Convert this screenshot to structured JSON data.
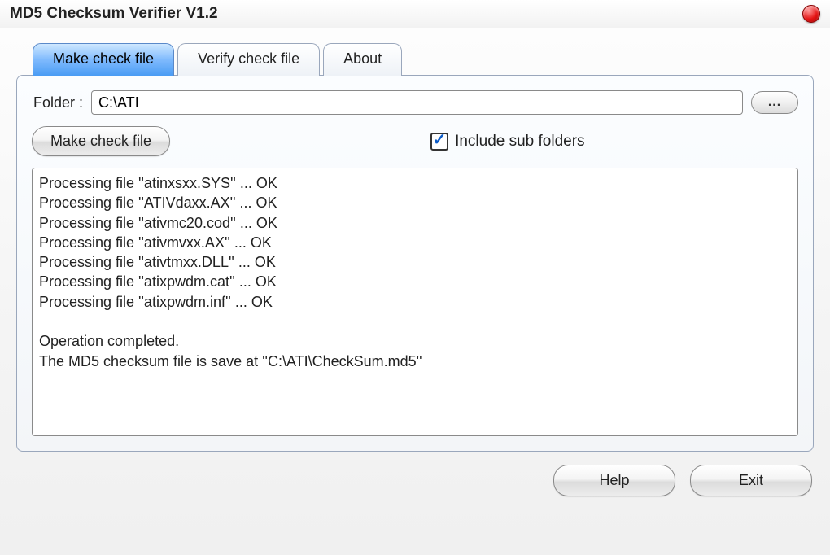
{
  "title": "MD5 Checksum Verifier V1.2",
  "tabs": [
    {
      "label": "Make check file",
      "active": true
    },
    {
      "label": "Verify check file",
      "active": false
    },
    {
      "label": "About",
      "active": false
    }
  ],
  "folder": {
    "label": "Folder :",
    "value": "C:\\ATI",
    "browse_label": "..."
  },
  "make_button_label": "Make check file",
  "include_sub": {
    "label": "Include sub folders",
    "checked": true
  },
  "log_text": "Processing file ''atinxsxx.SYS'' ... OK\nProcessing file ''ATIVdaxx.AX'' ... OK\nProcessing file ''ativmc20.cod'' ... OK\nProcessing file ''ativmvxx.AX'' ... OK\nProcessing file ''ativtmxx.DLL'' ... OK\nProcessing file ''atixpwdm.cat'' ... OK\nProcessing file ''atixpwdm.inf'' ... OK\n\nOperation completed.\nThe MD5 checksum file is save at ''C:\\ATI\\CheckSum.md5''",
  "buttons": {
    "help": "Help",
    "exit": "Exit"
  }
}
